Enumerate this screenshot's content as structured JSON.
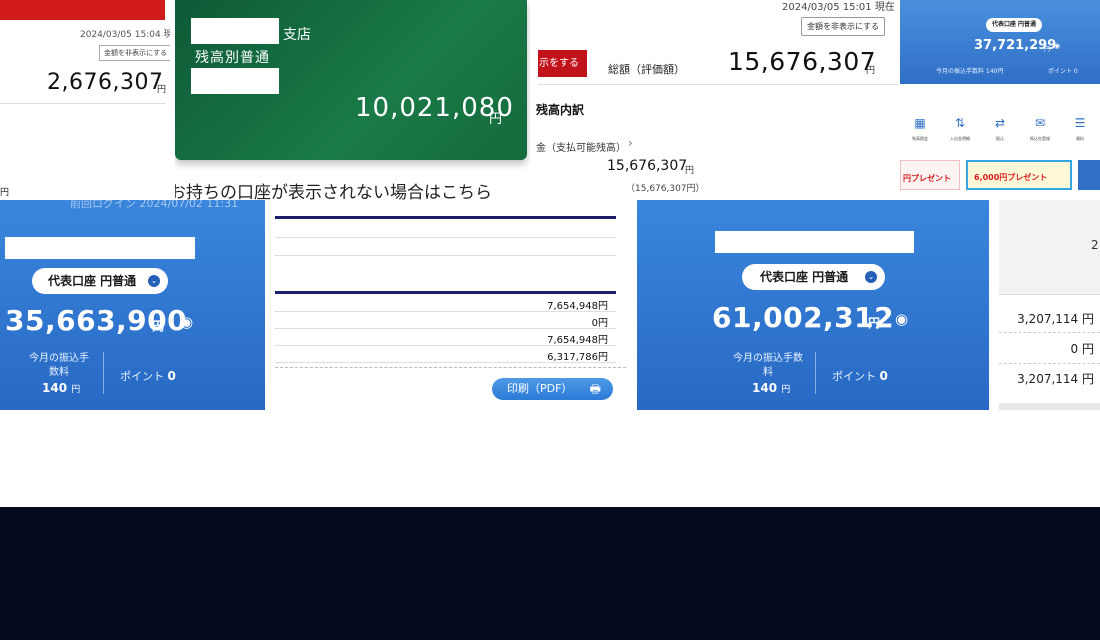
{
  "panel_a": {
    "timestamp": "2024/03/05 15:04 現",
    "hide_button": "金額を非表示にする",
    "amount": "2,676,307",
    "yen": "円",
    "fragment_1": "",
    "fragment_2": "円"
  },
  "panel_b": {
    "branch_label": "支店",
    "account_type": "残高別普通",
    "amount": "10,021,080",
    "yen": "円",
    "notice": "お持ちの口座が表示されない場合はこちら"
  },
  "panel_c": {
    "timestamp": "2024/03/05 15:01 現在",
    "hide_button": "金額を非表示にする",
    "red_button": "示をする",
    "total_label": "総額（評価額）",
    "amount": "15,676,307",
    "yen": "円",
    "section_title": "残高内訳",
    "item_label": "金（支払可能残高）",
    "item_amount": "15,676,307",
    "item_yen": "円",
    "item_sub": "（15,676,307円）"
  },
  "panel_d": {
    "pill": "代表口座 円普通",
    "amount": "37,721,299",
    "yen": "円",
    "fee": "今月の振込手数料 140円",
    "points": "ポイント 0",
    "icons": [
      {
        "label": "残高照会",
        "glyph": "▦"
      },
      {
        "label": "入出金明細",
        "glyph": "⇅"
      },
      {
        "label": "振込",
        "glyph": "⇄"
      },
      {
        "label": "振込先登録",
        "glyph": "✉"
      },
      {
        "label": "資料",
        "glyph": "☰"
      }
    ],
    "banner_1": "円プレゼント",
    "banner_2": "6,000円プレゼント"
  },
  "panel_e": {
    "faded": "前回ログイン 2024/07/02 11:31",
    "pill": "代表口座 円普通",
    "dropdown_glyph": "⌄",
    "amount": "35,663,900",
    "yen": "円",
    "eye_glyph": "👁",
    "fee_label": "今月の振込手数料",
    "fee_value": "140",
    "fee_unit": "円",
    "points_label": "ポイント",
    "points_value": "0"
  },
  "panel_f": {
    "values": [
      "7,654,948円",
      "0円",
      "7,654,948円",
      "6,317,786円"
    ],
    "print_button": "印刷（PDF）",
    "print_glyph": "🖶"
  },
  "panel_g": {
    "pill": "代表口座 円普通",
    "dropdown_glyph": "⌄",
    "amount": "61,002,312",
    "yen": "円",
    "eye_glyph": "👁",
    "fee_label": "今月の振込手数料",
    "fee_value": "140",
    "fee_unit": "円",
    "points_label": "ポイント",
    "points_value": "0"
  },
  "panel_h": {
    "header_number": "2",
    "values": [
      "3,207,114 円",
      "0 円",
      "3,207,114 円"
    ]
  },
  "colors": {
    "brand_red": "#d21b1b",
    "card_green": "#146a3c",
    "card_blue": "#2f6fc7",
    "table_navy": "#1b1f6b",
    "footer_dark": "#050b1f"
  }
}
